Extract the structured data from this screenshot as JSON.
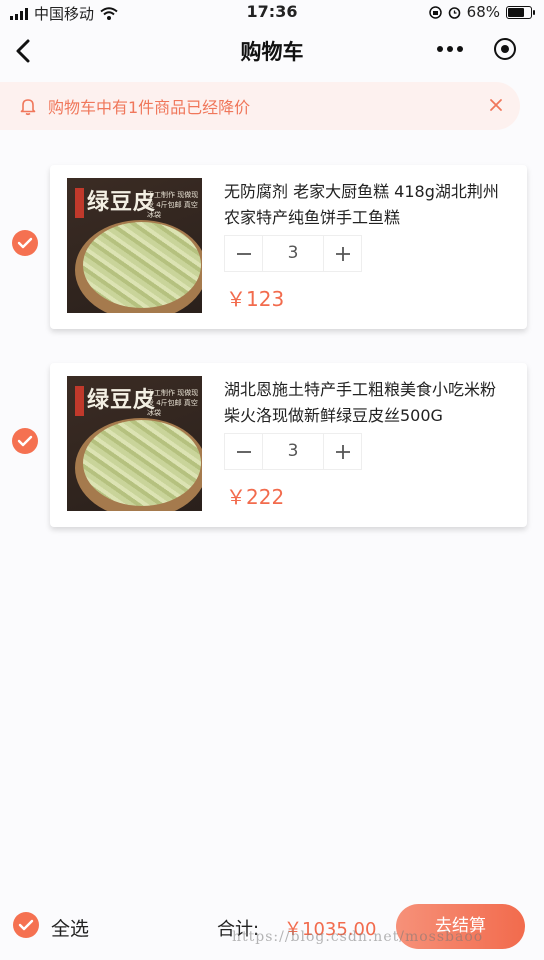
{
  "status_bar": {
    "carrier": "中国移动",
    "time": "17:36",
    "battery": "68%"
  },
  "nav": {
    "title": "购物车"
  },
  "notice": {
    "text": "购物车中有1件商品已经降价"
  },
  "items": [
    {
      "image_title": "绿豆皮",
      "image_subtitle": "手工制作 现做现发 4斤包邮 真空冰袋",
      "title": "无防腐剂 老家大厨鱼糕 418g湖北荆州农家特产纯鱼饼手工鱼糕",
      "quantity": "3",
      "price": "￥123",
      "checked": true
    },
    {
      "image_title": "绿豆皮",
      "image_subtitle": "手工制作 现做现发 4斤包邮 真空冰袋",
      "title": "湖北恩施土特产手工粗粮美食小吃米粉柴火洛现做新鲜绿豆皮丝500G",
      "quantity": "3",
      "price": "￥222",
      "checked": true
    }
  ],
  "bottom_bar": {
    "select_all_label": "全选",
    "total_label": "合计:",
    "total_value": "￥1035.00",
    "checkout_label": "去结算",
    "watermark": "https://blog.csdn.net/mossbaoo"
  },
  "colors": {
    "accent": "#f26b4d",
    "notice_bg": "#fdf1ef"
  }
}
